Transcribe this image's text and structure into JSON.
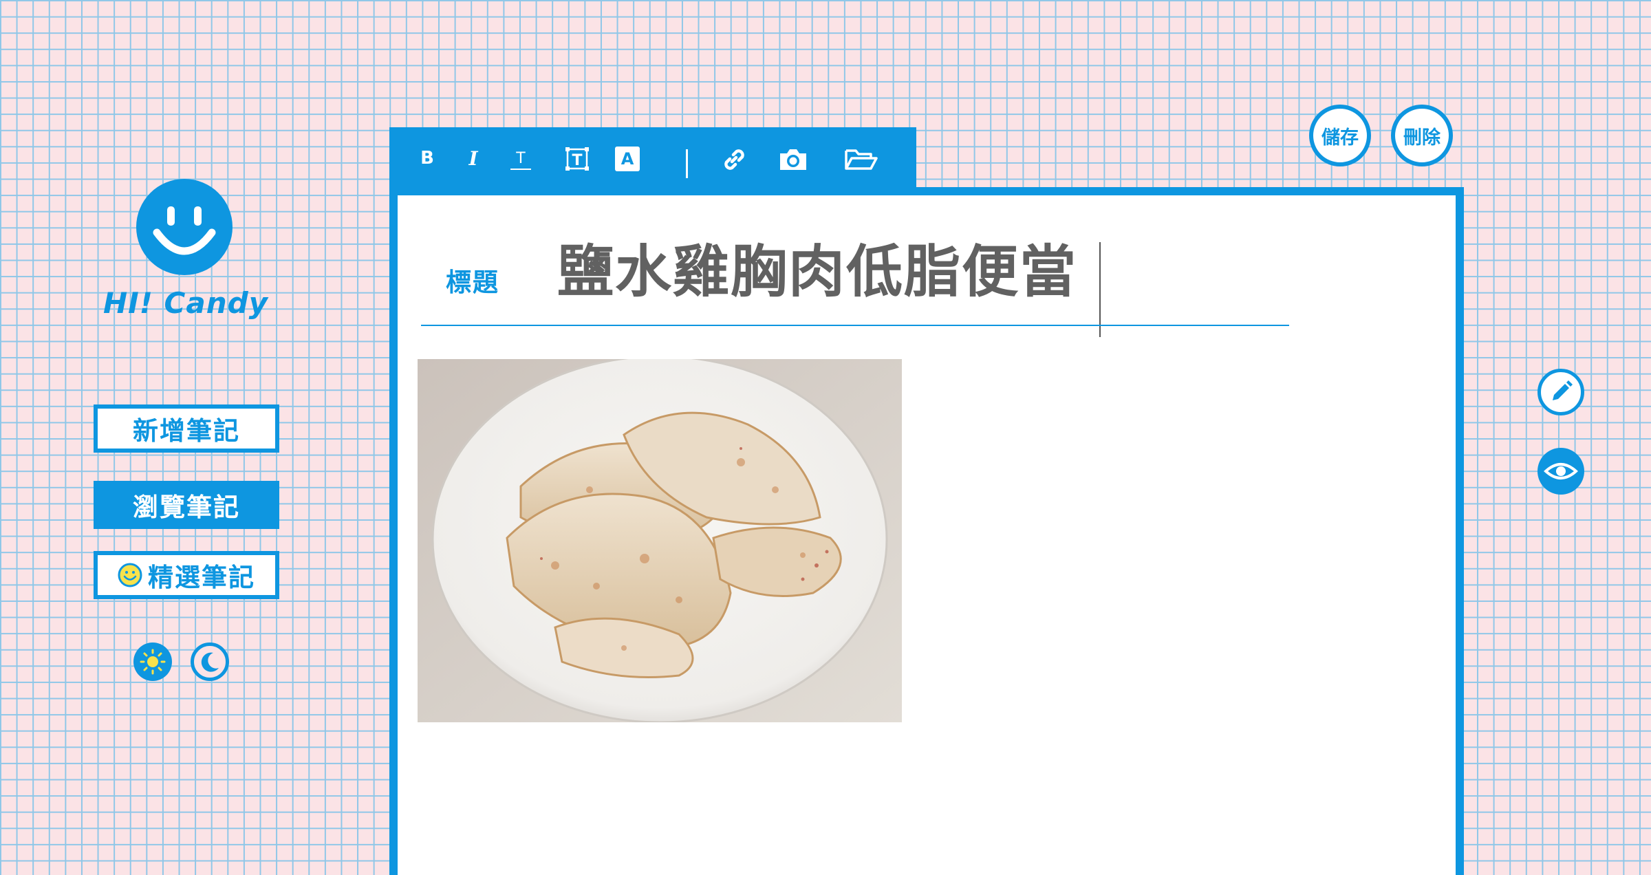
{
  "app": {
    "logo_text": "HI! Candy",
    "logo_icon": "smiley-face-icon"
  },
  "sidebar": {
    "items": [
      {
        "label": "新增筆記",
        "state": "outline"
      },
      {
        "label": "瀏覽筆記",
        "state": "active"
      },
      {
        "label": "精選筆記",
        "state": "outline",
        "icon": "smiley-icon"
      }
    ],
    "theme_toggle": {
      "light_icon": "sun-icon",
      "dark_icon": "moon-icon",
      "selected": "light"
    }
  },
  "toolbar": {
    "buttons": [
      {
        "name": "bold",
        "glyph": "B"
      },
      {
        "name": "italic",
        "glyph": "I"
      },
      {
        "name": "text-size",
        "glyph": "T"
      },
      {
        "name": "text-box",
        "glyph": "T"
      },
      {
        "name": "text-color",
        "glyph": "A"
      },
      {
        "name": "link",
        "icon": "link-icon"
      },
      {
        "name": "camera",
        "icon": "camera-icon"
      },
      {
        "name": "folder",
        "icon": "folder-open-icon"
      }
    ]
  },
  "editor": {
    "title_label": "標題",
    "title_value": "鹽水雞胸肉低脂便當",
    "image_alt": "chicken-breast-photo"
  },
  "actions": {
    "save_label": "儲存",
    "delete_label": "刪除"
  },
  "mode": {
    "edit_icon": "pencil-icon",
    "preview_icon": "eye-icon",
    "selected": "preview"
  },
  "colors": {
    "accent": "#0e96e0",
    "background": "#fbe3e6",
    "grid": "#8fc7e8",
    "title_text": "#616161"
  }
}
